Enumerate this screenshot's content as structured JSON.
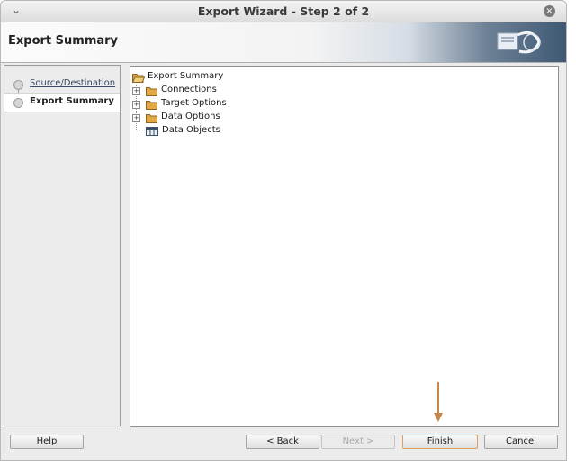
{
  "window": {
    "title": "Export Wizard - Step 2 of 2"
  },
  "header": {
    "heading": "Export Summary"
  },
  "steps": [
    {
      "label": "Source/Destination",
      "state": "visited"
    },
    {
      "label": "Export Summary",
      "state": "current"
    }
  ],
  "tree": {
    "root": "Export Summary",
    "children": [
      {
        "label": "Connections",
        "icon": "folder-icon",
        "expandable": true
      },
      {
        "label": "Target Options",
        "icon": "folder-icon",
        "expandable": true
      },
      {
        "label": "Data Options",
        "icon": "folder-icon",
        "expandable": true
      },
      {
        "label": "Data Objects",
        "icon": "table-icon",
        "expandable": false
      }
    ]
  },
  "buttons": {
    "help": "Help",
    "back": "< Back",
    "next": "Next >",
    "finish": "Finish",
    "cancel": "Cancel"
  },
  "colors": {
    "arrow": "#c8874a",
    "focus_border": "#d9a05e"
  }
}
